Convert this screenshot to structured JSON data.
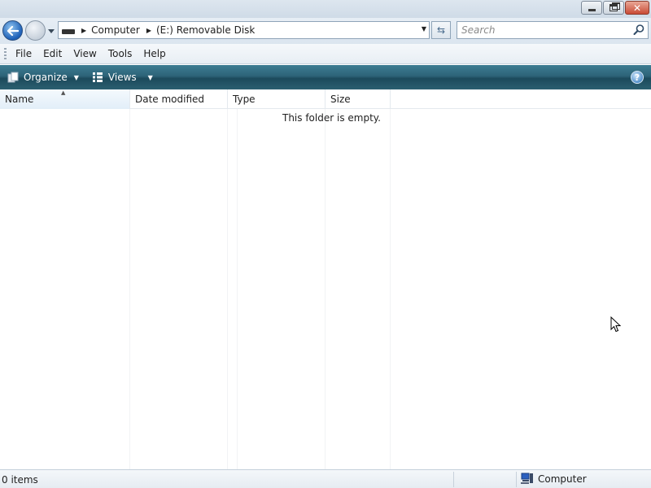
{
  "titlebar": {
    "minimize_icon": "minimize-icon",
    "maximize_icon": "restore-icon",
    "close_icon": "close-icon"
  },
  "nav": {
    "breadcrumbs": [
      "Computer",
      "(E:) Removable Disk"
    ],
    "search_placeholder": "Search"
  },
  "menu": {
    "items": [
      "File",
      "Edit",
      "View",
      "Tools",
      "Help"
    ]
  },
  "command_bar": {
    "organize_label": "Organize",
    "views_label": "Views",
    "help_label": "?"
  },
  "columns": {
    "name": "Name",
    "date_modified": "Date modified",
    "type": "Type",
    "size": "Size"
  },
  "content": {
    "empty_message": "This folder is empty."
  },
  "status": {
    "item_count": "0 items",
    "location": "Computer"
  },
  "colors": {
    "command_bar": "#2d6378",
    "accent_blue": "#1c5fb7",
    "close_red": "#c94b35"
  }
}
